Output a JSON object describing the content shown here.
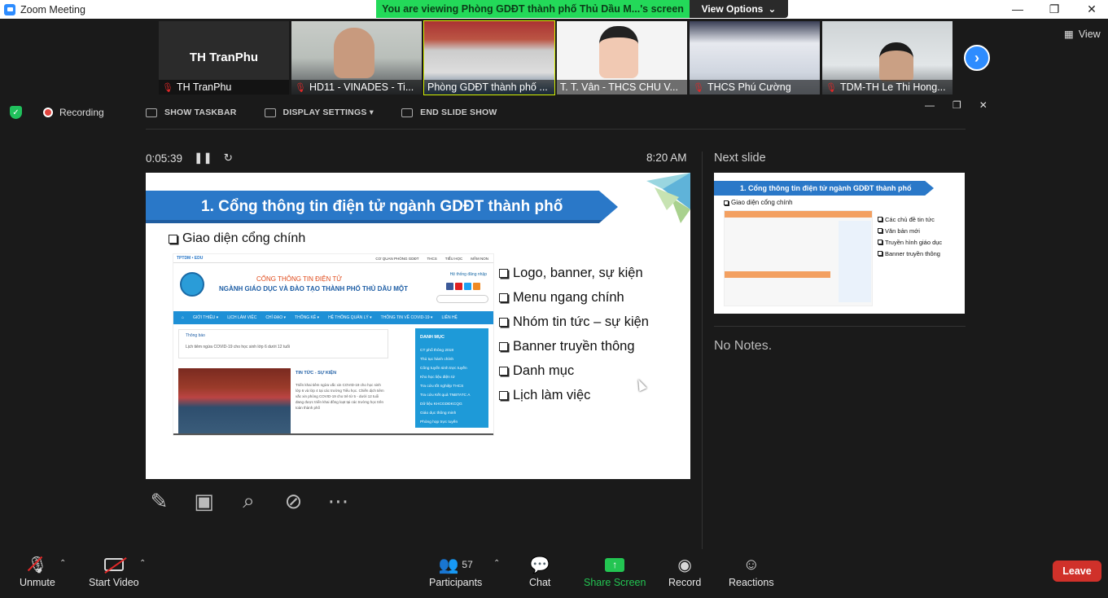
{
  "window": {
    "title": "Zoom Meeting"
  },
  "banner": {
    "text": "You are viewing Phòng GDĐT thành phố Thủ Dầu M...'s screen",
    "view_options": "View Options"
  },
  "participants_strip": [
    {
      "name": "TH TranPhu",
      "big": "TH TranPhu"
    },
    {
      "name": "HD11 - VINADES - Ti..."
    },
    {
      "name": "Phòng GDĐT thành phố ..."
    },
    {
      "name": "T. T. Vân  - THCS CHU V..."
    },
    {
      "name": "THCS Phú Cường"
    },
    {
      "name": "TDM-TH Le Thi Hong..."
    }
  ],
  "view_label": "View",
  "recording_label": "Recording",
  "presenter": {
    "show_taskbar": "SHOW TASKBAR",
    "display_settings": "DISPLAY SETTINGS ▾",
    "end_slide_show": "END SLIDE SHOW",
    "timer": "0:05:39",
    "clock": "8:20 AM",
    "next_slide_label": "Next slide",
    "notes": "No Notes."
  },
  "slide": {
    "title": "1. Cổng thông tin điện tử ngành GDĐT thành phố",
    "subtitle": "Giao diện cổng chính",
    "bullets": [
      "Logo, banner, sự kiện",
      "Menu ngang chính",
      "Nhóm tin tức – sự kiện",
      "Banner truyền thông",
      "Danh mục",
      "Lịch làm việc"
    ],
    "portal": {
      "brand": "TPTDM • EDU",
      "topnav": [
        "CƠ QUAN PHÒNG GDĐT",
        "THCS",
        "TIỂU HỌC",
        "MẦM NON"
      ],
      "heading1": "CỔNG THÔNG TIN ĐIỆN TỬ",
      "heading2": "NGÀNH GIÁO DỤC VÀ ĐÀO TẠO THÀNH PHỐ THỦ DẦU MỘT",
      "right_top": "Hệ thống đăng nhập",
      "nav": [
        "GIỚI THIỆU ▾",
        "LỊCH LÀM VIỆC",
        "CHỈ ĐẠO ▾",
        "THỐNG KÊ ▾",
        "HỆ THỐNG QUẢN LÝ ▾",
        "THÔNG TIN VỀ COVID-19 ▾",
        "LIÊN HỆ"
      ],
      "notice_title": "Thông báo",
      "notice_text": "Lịch tiêm ngừa COVID-19 cho học sinh lớp 6 dưới 12 tuổi",
      "danhmuc_title": "DANH MỤC",
      "danhmuc": [
        "CT phổ thông 2018",
        "Thủ tục hành chính",
        "Công tuyển sinh trực tuyến",
        "Kho học liệu điện tử",
        "Tra cứu tốt nghiệp THCS",
        "Tra cứu Kết quả TNBTATC A",
        "Dữ liệu KHCGDĐKCQG",
        "Giáo dục thông minh",
        "Phòng họp trực tuyến"
      ],
      "news_title": "TIN TỨC - SỰ KIỆN",
      "news_text": "Triển khai tiêm ngừa vắc xin COVID-19 cho học sinh lớp 6 và lớp 4 tại các trường Tiểu học. Chiến dịch tiêm vắc xin phòng COVID-19 cho trẻ từ 5 - dưới 12 tuổi đang được triển khai đồng loạt tại các trường học trên toàn thành phố"
    }
  },
  "next_slide": {
    "title": "1. Cổng thông tin điện tử ngành GDĐT thành phố",
    "subtitle": "Giao diện cổng chính",
    "bullets": [
      "Các chủ đề tin tức",
      "Văn bản mới",
      "Truyền hình giáo dục",
      "Banner truyền thông"
    ]
  },
  "toolbar": {
    "unmute": "Unmute",
    "start_video": "Start Video",
    "participants": "Participants",
    "participants_count": "57",
    "chat": "Chat",
    "share_screen": "Share Screen",
    "record": "Record",
    "reactions": "Reactions",
    "leave": "Leave"
  },
  "colors": {
    "zoom_blue": "#2d8cff",
    "share_green": "#23c552",
    "leave_red": "#d0312a",
    "banner_green": "#23d959"
  }
}
